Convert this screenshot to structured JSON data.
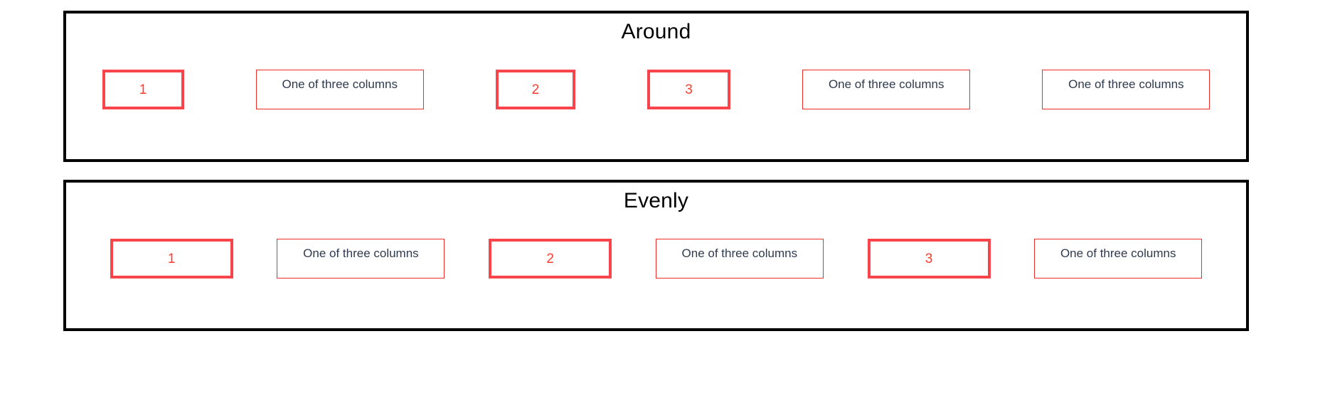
{
  "panels": [
    {
      "title": "Around",
      "justify": "space-around",
      "items": [
        {
          "kind": "number",
          "label": "1"
        },
        {
          "kind": "text",
          "label": "One of three columns"
        },
        {
          "kind": "number",
          "label": "2"
        },
        {
          "kind": "number",
          "label": "3"
        },
        {
          "kind": "text",
          "label": "One of three columns"
        },
        {
          "kind": "text",
          "label": "One of three columns"
        }
      ]
    },
    {
      "title": "Evenly",
      "justify": "space-evenly",
      "items": [
        {
          "kind": "number",
          "label": "1"
        },
        {
          "kind": "text",
          "label": "One of three columns"
        },
        {
          "kind": "number",
          "label": "2"
        },
        {
          "kind": "text",
          "label": "One of three columns"
        },
        {
          "kind": "number",
          "label": "3"
        },
        {
          "kind": "text",
          "label": "One of three columns"
        }
      ]
    }
  ],
  "colors": {
    "panel_border": "#000000",
    "number_box_border": "#f8444b",
    "text_box_border": "#ef2b24",
    "number_text": "#ff3b30",
    "label_text": "#2e3a4d",
    "title_text": "#000000",
    "background": "#ffffff"
  }
}
